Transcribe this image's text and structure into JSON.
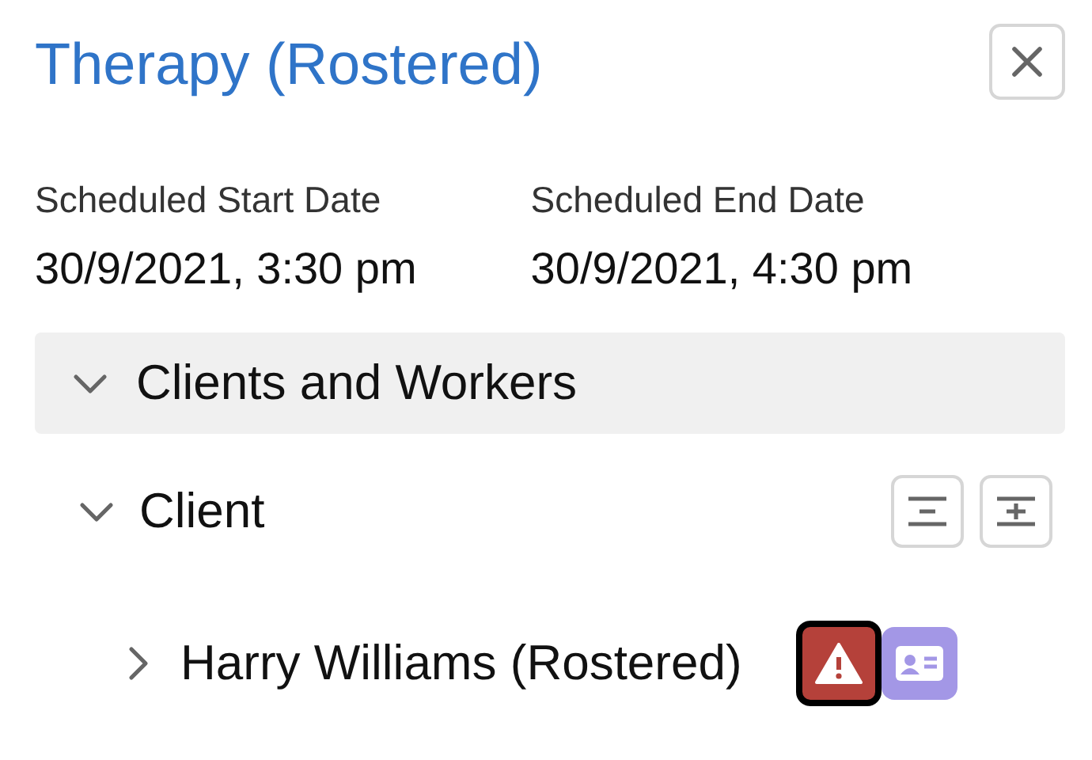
{
  "title": "Therapy (Rostered)",
  "dates": [
    {
      "label": "Scheduled Start Date",
      "value": "30/9/2021, 3:30 pm"
    },
    {
      "label": "Scheduled End Date",
      "value": "30/9/2021, 4:30 pm"
    }
  ],
  "section": {
    "title": "Clients and Workers",
    "expanded": true,
    "group": {
      "title": "Client",
      "expanded": true,
      "items": [
        {
          "name": "Harry Williams (Rostered)",
          "expanded": false,
          "warning_focused": true
        }
      ]
    }
  }
}
